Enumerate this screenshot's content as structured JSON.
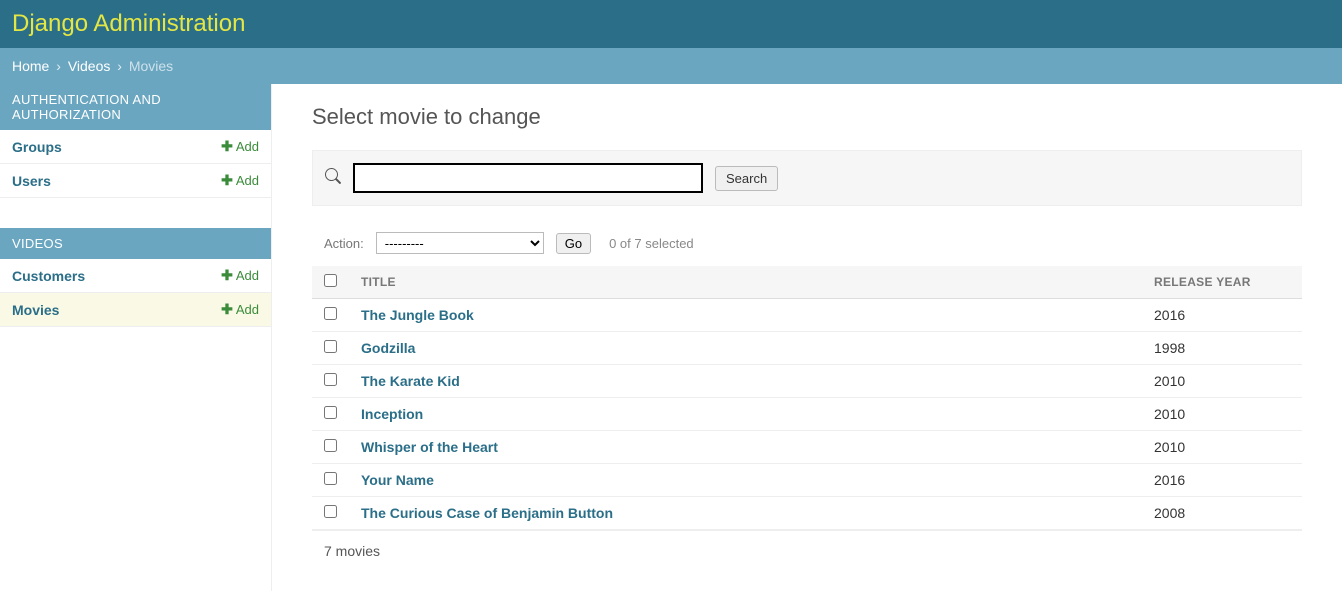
{
  "header": {
    "title": "Django Administration"
  },
  "breadcrumbs": {
    "home": "Home",
    "videos": "Videos",
    "current": "Movies"
  },
  "sidebar": {
    "sections": [
      {
        "title": "AUTHENTICATION AND AUTHORIZATION",
        "items": [
          {
            "label": "Groups",
            "add": "Add"
          },
          {
            "label": "Users",
            "add": "Add"
          }
        ]
      },
      {
        "title": "VIDEOS",
        "items": [
          {
            "label": "Customers",
            "add": "Add"
          },
          {
            "label": "Movies",
            "add": "Add"
          }
        ]
      }
    ]
  },
  "main": {
    "title": "Select movie to change",
    "search": {
      "button": "Search",
      "placeholder": ""
    },
    "action": {
      "label": "Action:",
      "selected": "---------",
      "go": "Go",
      "selection": "0 of 7 selected"
    },
    "table": {
      "headers": {
        "title": "TITLE",
        "year": "RELEASE YEAR"
      },
      "rows": [
        {
          "title": "The Jungle Book",
          "year": "2016"
        },
        {
          "title": "Godzilla",
          "year": "1998"
        },
        {
          "title": "The Karate Kid",
          "year": "2010"
        },
        {
          "title": "Inception",
          "year": "2010"
        },
        {
          "title": "Whisper of the Heart",
          "year": "2010"
        },
        {
          "title": "Your Name",
          "year": "2016"
        },
        {
          "title": "The Curious Case of Benjamin Button",
          "year": "2008"
        }
      ],
      "footer": "7 movies"
    }
  }
}
